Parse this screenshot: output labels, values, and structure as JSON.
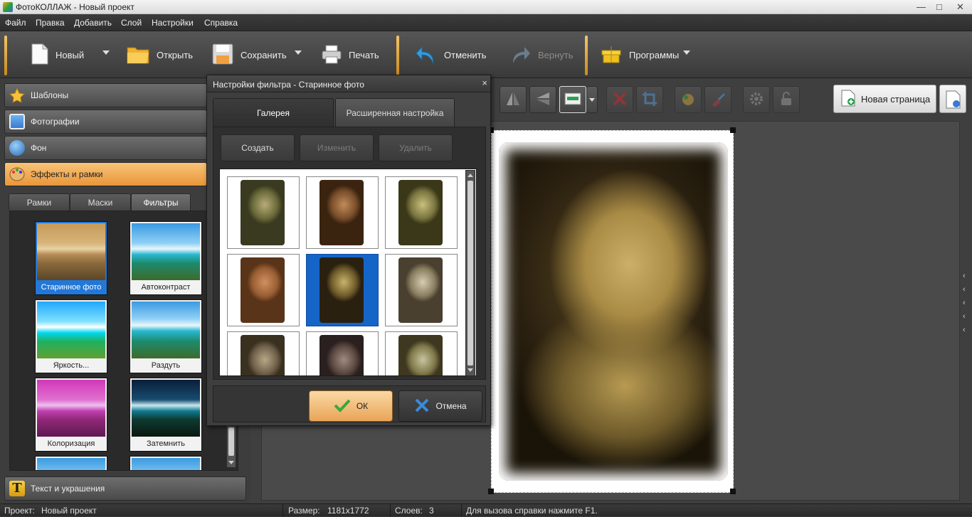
{
  "window": {
    "title": "ФотоКОЛЛАЖ - Новый проект"
  },
  "menu": [
    "Файл",
    "Правка",
    "Добавить",
    "Слой",
    "Настройки",
    "Справка"
  ],
  "toolbar": {
    "new_label": "Новый",
    "open_label": "Открыть",
    "save_label": "Сохранить",
    "print_label": "Печать",
    "undo_label": "Отменить",
    "redo_label": "Вернуть",
    "programs_label": "Программы"
  },
  "sidebar": {
    "categories": [
      {
        "label": "Шаблоны",
        "icon": "star-icon"
      },
      {
        "label": "Фотографии",
        "icon": "photo-icon"
      },
      {
        "label": "Фон",
        "icon": "background-icon"
      },
      {
        "label": "Эффекты и рамки",
        "icon": "palette-icon",
        "active": true
      }
    ],
    "tabs": [
      "Рамки",
      "Маски",
      "Фильтры"
    ],
    "active_tab": "Фильтры",
    "filters": [
      {
        "label": "Старинное фото",
        "selected": true
      },
      {
        "label": "Автоконтраст"
      },
      {
        "label": "Яркость..."
      },
      {
        "label": "Раздуть"
      },
      {
        "label": "Колоризация"
      },
      {
        "label": "Затемнить"
      }
    ],
    "text_category": {
      "label": "Текст и украшения",
      "icon": "text-t-icon"
    }
  },
  "editor": {
    "new_page_label": "Новая страница"
  },
  "dialog": {
    "title": "Настройки фильтра - Старинное фото",
    "close": "×",
    "tabs": [
      "Галерея",
      "Расширенная настройка"
    ],
    "active_tab": "Галерея",
    "buttons": {
      "create": "Создать",
      "edit": "Изменить",
      "delete": "Удалить"
    },
    "gallery_selected_index": 4,
    "ok_label": "ОК",
    "cancel_label": "Отмена"
  },
  "status": {
    "project_label": "Проект:",
    "project_value": "Новый проект",
    "size_label": "Размер:",
    "size_value": "1181x1772",
    "layers_label": "Слоев:",
    "layers_value": "3",
    "help_text": "Для вызова справки нажмите F1."
  },
  "colors": {
    "accent_orange": "#f0a040",
    "selection_blue": "#2278d8"
  }
}
